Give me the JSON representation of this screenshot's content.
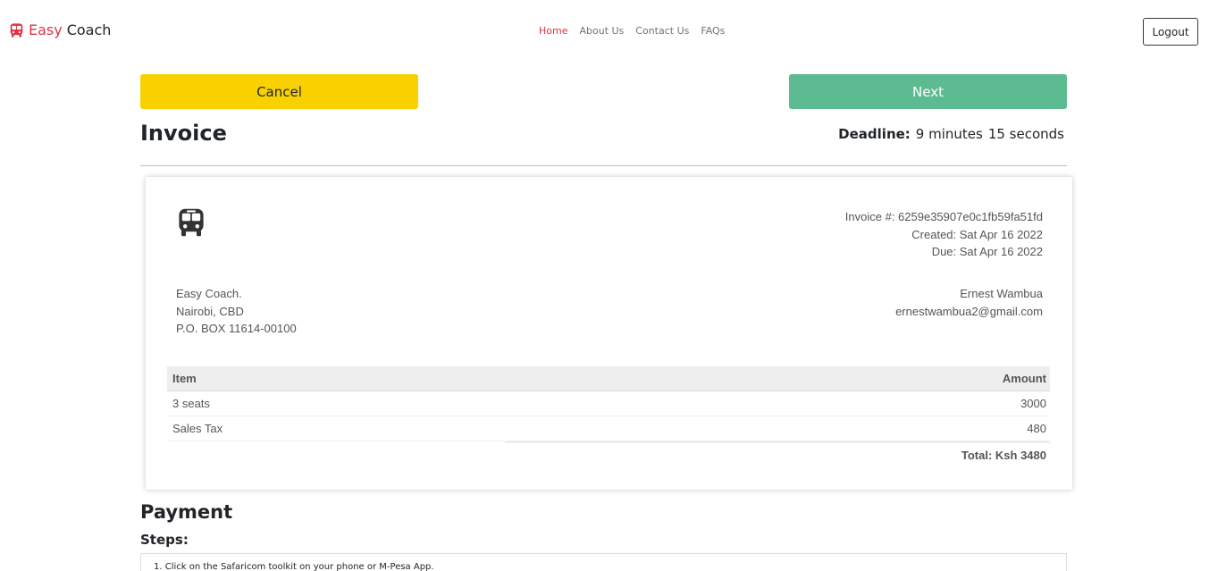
{
  "brand": {
    "name_part1": "Easy",
    "name_part2": "Coach",
    "icon": "bus-icon",
    "color": "#dc3545"
  },
  "nav": {
    "items": [
      {
        "label": "Home",
        "active": true
      },
      {
        "label": "About Us",
        "active": false
      },
      {
        "label": "Contact Us",
        "active": false
      },
      {
        "label": "FAQs",
        "active": false
      }
    ],
    "logout_label": "Logout"
  },
  "actions": {
    "cancel_label": "Cancel",
    "next_label": "Next",
    "cancel_color": "#f9d100",
    "next_color": "#5dbb91"
  },
  "page": {
    "title": "Invoice",
    "deadline_label": "Deadline:",
    "deadline_minutes": "9 minutes",
    "deadline_seconds": "15 seconds"
  },
  "invoice": {
    "logo_icon": "bus-icon",
    "number_line": "Invoice #: 6259e35907e0c1fb59fa51fd",
    "created_line": "Created: Sat Apr 16 2022",
    "due_line": "Due: Sat Apr 16 2022",
    "from": {
      "name": "Easy Coach.",
      "city": "Nairobi, CBD",
      "box": "P.O. BOX 11614-00100"
    },
    "to": {
      "name": "Ernest Wambua",
      "email": "ernestwambua2@gmail.com"
    },
    "table": {
      "headers": {
        "item": "Item",
        "amount": "Amount"
      },
      "rows": [
        {
          "item": "3 seats",
          "amount": "3000"
        },
        {
          "item": "Sales Tax",
          "amount": "480"
        }
      ],
      "total": "Total: Ksh 3480"
    }
  },
  "payment": {
    "title": "Payment",
    "steps_title": "Steps:",
    "steps": [
      "1. Click on the Safaricom toolkit on your phone or M-Pesa App."
    ]
  }
}
